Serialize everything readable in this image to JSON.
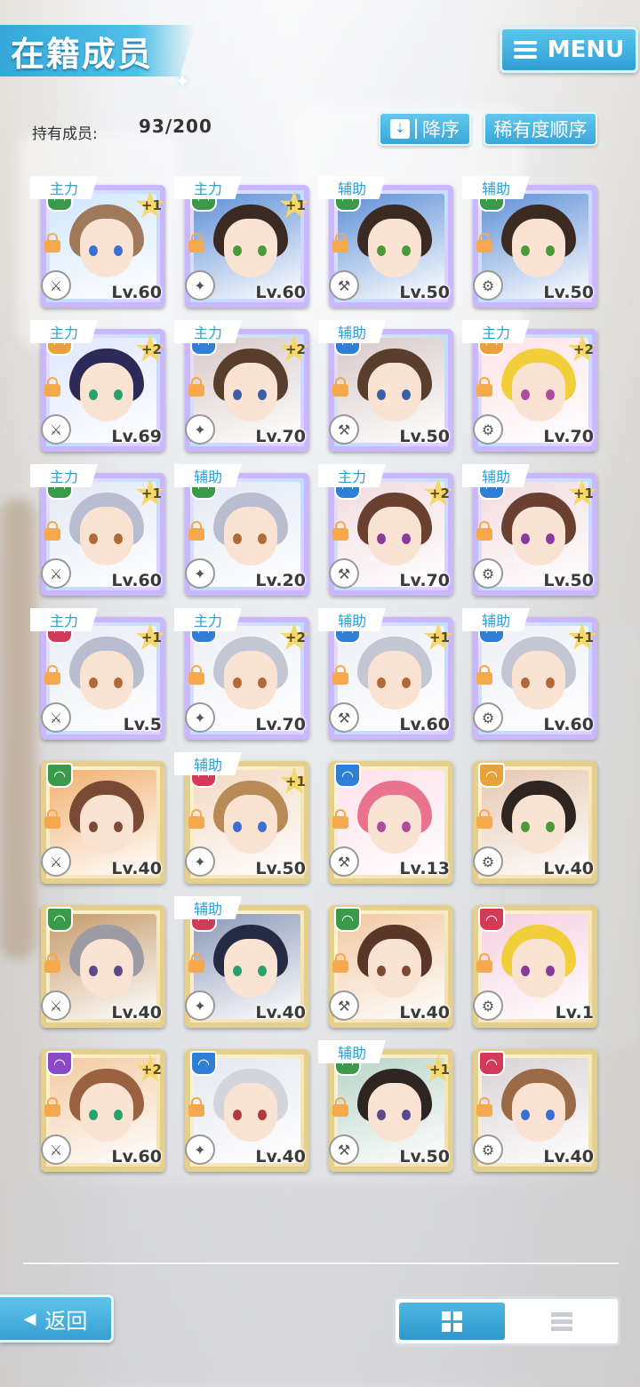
{
  "header": {
    "title": "在籍成员",
    "menu_label": "MENU"
  },
  "owned": {
    "label": "持有成员:",
    "count": "93/200"
  },
  "sort": {
    "order_label": "降序",
    "rarity_label": "稀有度顺序"
  },
  "cards": [
    {
      "role": "主力",
      "plus": "+1",
      "level": "Lv.60",
      "frame": "rainbow",
      "hair": "#a0795a",
      "eye": "#3b6fd1",
      "attr": "#3a9a4a",
      "bg": "#cfe7ff"
    },
    {
      "role": "主力",
      "plus": "+1",
      "level": "Lv.60",
      "frame": "rainbow",
      "hair": "#3b2a22",
      "eye": "#4a9a3a",
      "attr": "#3a9a4a",
      "bg": "#5e8fd6"
    },
    {
      "role": "辅助",
      "plus": "",
      "level": "Lv.50",
      "frame": "rainbow",
      "hair": "#3b2a22",
      "eye": "#4a9a3a",
      "attr": "#3a9a4a",
      "bg": "#5e8fd6"
    },
    {
      "role": "辅助",
      "plus": "",
      "level": "Lv.50",
      "frame": "rainbow",
      "hair": "#3b2a22",
      "eye": "#4a9a3a",
      "attr": "#3a9a4a",
      "bg": "#5e8fd6"
    },
    {
      "role": "主力",
      "plus": "+2",
      "level": "Lv.69",
      "frame": "rainbow",
      "hair": "#2d2a58",
      "eye": "#2aa070",
      "attr": "#e9a23a",
      "bg": "#dfe7ff"
    },
    {
      "role": "主力",
      "plus": "+2",
      "level": "Lv.70",
      "frame": "rainbow",
      "hair": "#5a3e2c",
      "eye": "#3b5fa8",
      "attr": "#2f7fd6",
      "bg": "#d7c8c8"
    },
    {
      "role": "辅助",
      "plus": "",
      "level": "Lv.50",
      "frame": "rainbow",
      "hair": "#5a3e2c",
      "eye": "#3b5fa8",
      "attr": "#2f7fd6",
      "bg": "#d7c8c8"
    },
    {
      "role": "主力",
      "plus": "+2",
      "level": "Lv.70",
      "frame": "rainbow",
      "hair": "#f2cf3a",
      "eye": "#b04aa0",
      "attr": "#e9a23a",
      "bg": "#ffe3e8"
    },
    {
      "role": "主力",
      "plus": "+1",
      "level": "Lv.60",
      "frame": "rainbow",
      "hair": "#b9bdd0",
      "eye": "#b06a3a",
      "attr": "#3a9a4a",
      "bg": "#e2e8f4"
    },
    {
      "role": "辅助",
      "plus": "",
      "level": "Lv.20",
      "frame": "rainbow",
      "hair": "#b9bdd0",
      "eye": "#b06a3a",
      "attr": "#3a9a4a",
      "bg": "#e2e8f4"
    },
    {
      "role": "主力",
      "plus": "+2",
      "level": "Lv.70",
      "frame": "rainbow",
      "hair": "#6a4030",
      "eye": "#8a3a9a",
      "attr": "#2f7fd6",
      "bg": "#f2dce0"
    },
    {
      "role": "辅助",
      "plus": "+1",
      "level": "Lv.50",
      "frame": "rainbow",
      "hair": "#6a4030",
      "eye": "#8a3a9a",
      "attr": "#2f7fd6",
      "bg": "#f2dce0"
    },
    {
      "role": "主力",
      "plus": "+1",
      "level": "Lv.5",
      "frame": "rainbow",
      "hair": "#b9bdd0",
      "eye": "#b06a3a",
      "attr": "#d23a58",
      "bg": "#e8ecf5"
    },
    {
      "role": "主力",
      "plus": "+2",
      "level": "Lv.70",
      "frame": "rainbow",
      "hair": "#c3c6d3",
      "eye": "#b06a3a",
      "attr": "#2f7fd6",
      "bg": "#eef0f6"
    },
    {
      "role": "辅助",
      "plus": "+1",
      "level": "Lv.60",
      "frame": "rainbow",
      "hair": "#c3c6d3",
      "eye": "#b06a3a",
      "attr": "#2f7fd6",
      "bg": "#eef0f6"
    },
    {
      "role": "辅助",
      "plus": "+1",
      "level": "Lv.60",
      "frame": "rainbow",
      "hair": "#c3c6d3",
      "eye": "#b06a3a",
      "attr": "#2f7fd6",
      "bg": "#eef0f6"
    },
    {
      "role": "",
      "plus": "",
      "level": "Lv.40",
      "frame": "gold",
      "hair": "#7a4a34",
      "eye": "#7a4a34",
      "attr": "#3a9a4a",
      "bg": "#f2b070"
    },
    {
      "role": "辅助",
      "plus": "+1",
      "level": "Lv.50",
      "frame": "gold",
      "hair": "#b98a56",
      "eye": "#3b6fd1",
      "attr": "#d23a58",
      "bg": "#f3d9c2"
    },
    {
      "role": "",
      "plus": "",
      "level": "Lv.13",
      "frame": "gold",
      "hair": "#e9738f",
      "eye": "#b04aa0",
      "attr": "#2f7fd6",
      "bg": "#ffe0ea"
    },
    {
      "role": "",
      "plus": "",
      "level": "Lv.40",
      "frame": "gold",
      "hair": "#2e2420",
      "eye": "#4a9a3a",
      "attr": "#e9a23a",
      "bg": "#e6c7b0"
    },
    {
      "role": "",
      "plus": "",
      "level": "Lv.40",
      "frame": "gold",
      "hair": "#9c9aa2",
      "eye": "#5a4a8a",
      "attr": "#3a9a4a",
      "bg": "#c59a6a"
    },
    {
      "role": "辅助",
      "plus": "",
      "level": "Lv.40",
      "frame": "gold",
      "hair": "#252a45",
      "eye": "#2aa070",
      "attr": "#d23a58",
      "bg": "#8a98b8"
    },
    {
      "role": "",
      "plus": "",
      "level": "Lv.40",
      "frame": "gold",
      "hair": "#5a3626",
      "eye": "#7a4a34",
      "attr": "#3a9a4a",
      "bg": "#f1c8a0"
    },
    {
      "role": "",
      "plus": "",
      "level": "Lv.1",
      "frame": "gold",
      "hair": "#f2cf3a",
      "eye": "#8a3a9a",
      "attr": "#d23a58",
      "bg": "#f6cfe0"
    },
    {
      "role": "",
      "plus": "+2",
      "level": "Lv.60",
      "frame": "gold",
      "hair": "#9a6240",
      "eye": "#2aa070",
      "attr": "#8a4ac8",
      "bg": "#f2c9a0"
    },
    {
      "role": "",
      "plus": "",
      "level": "Lv.40",
      "frame": "gold",
      "hair": "#d4d4dc",
      "eye": "#b03a3a",
      "attr": "#2f7fd6",
      "bg": "#e4e8ee"
    },
    {
      "role": "辅助",
      "plus": "+1",
      "level": "Lv.50",
      "frame": "gold",
      "hair": "#2e2420",
      "eye": "#5a4a8a",
      "attr": "#3a9a4a",
      "bg": "#b8d4c8"
    },
    {
      "role": "",
      "plus": "",
      "level": "Lv.40",
      "frame": "gold",
      "hair": "#9a6a46",
      "eye": "#3b6fd1",
      "attr": "#d23a58",
      "bg": "#d9d2d6"
    }
  ],
  "footer": {
    "back_label": "返回"
  }
}
